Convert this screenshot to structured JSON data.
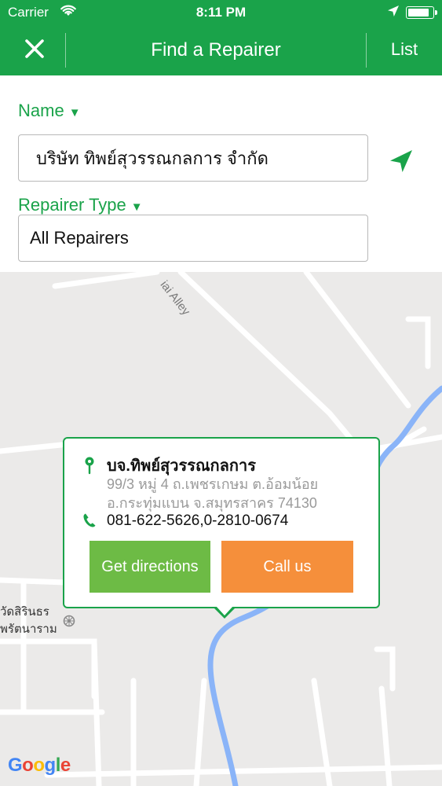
{
  "status": {
    "carrier": "Carrier",
    "time": "8:11 PM",
    "battery_level": 0.88
  },
  "nav": {
    "title": "Find a Repairer",
    "list_label": "List"
  },
  "form": {
    "name_label": "Name",
    "name_value": "บริษัท ทิพย์สุวรรณกลการ จำกัด",
    "type_label": "Repairer Type",
    "type_value": "All Repairers"
  },
  "map": {
    "street_label": "iai Alley",
    "temple_line1": "วัดสิรินธร",
    "temple_line2": "พรัตนาราม",
    "attribution": [
      "G",
      "o",
      "o",
      "g",
      "l",
      "e"
    ]
  },
  "popup": {
    "name": "บจ.ทิพย์สุวรรณกลการ",
    "address_line1": "99/3 หมู่ 4 ถ.เพชรเกษม ต.อ้อมน้อย",
    "address_line2": "อ.กระทุ่มแบน จ.สมุทรสาคร 74130",
    "phone": "081-622-5626,0-2810-0674",
    "directions_label": "Get directions",
    "call_label": "Call us"
  },
  "colors": {
    "brand_green": "#1aa34a",
    "directions_green": "#6dbb45",
    "call_orange": "#f58f3b",
    "water_blue": "#8ab4f8"
  },
  "icons": [
    "wifi-icon",
    "location-arrow-icon",
    "battery-icon",
    "close-icon",
    "navigate-arrow-icon",
    "map-pin-icon",
    "phone-icon",
    "temple-icon"
  ]
}
